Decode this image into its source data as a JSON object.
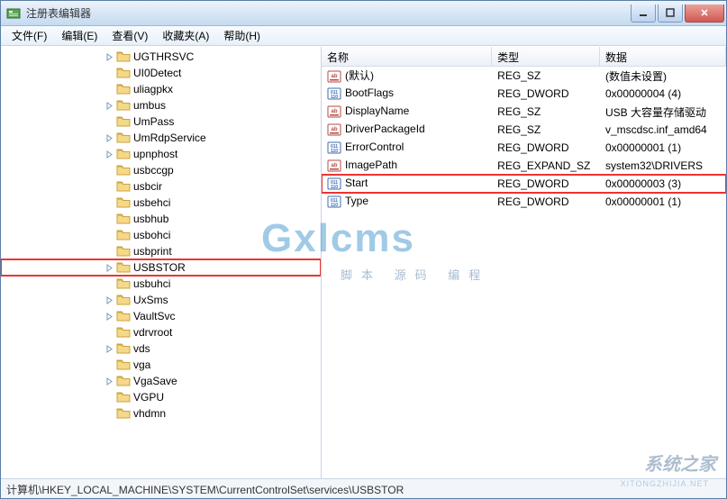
{
  "window": {
    "title": "注册表编辑器"
  },
  "menu": {
    "file": "文件(F)",
    "edit": "编辑(E)",
    "view": "查看(V)",
    "favorites": "收藏夹(A)",
    "help": "帮助(H)"
  },
  "tree": {
    "items": [
      {
        "label": "UGTHRSVC",
        "expander": "closed"
      },
      {
        "label": "UI0Detect",
        "expander": "none"
      },
      {
        "label": "uliagpkx",
        "expander": "none"
      },
      {
        "label": "umbus",
        "expander": "closed"
      },
      {
        "label": "UmPass",
        "expander": "none"
      },
      {
        "label": "UmRdpService",
        "expander": "closed"
      },
      {
        "label": "upnphost",
        "expander": "closed"
      },
      {
        "label": "usbccgp",
        "expander": "none"
      },
      {
        "label": "usbcir",
        "expander": "none"
      },
      {
        "label": "usbehci",
        "expander": "none"
      },
      {
        "label": "usbhub",
        "expander": "none"
      },
      {
        "label": "usbohci",
        "expander": "none"
      },
      {
        "label": "usbprint",
        "expander": "none"
      },
      {
        "label": "USBSTOR",
        "expander": "closed",
        "highlighted": true
      },
      {
        "label": "usbuhci",
        "expander": "none"
      },
      {
        "label": "UxSms",
        "expander": "closed"
      },
      {
        "label": "VaultSvc",
        "expander": "closed"
      },
      {
        "label": "vdrvroot",
        "expander": "none"
      },
      {
        "label": "vds",
        "expander": "closed"
      },
      {
        "label": "vga",
        "expander": "none"
      },
      {
        "label": "VgaSave",
        "expander": "closed"
      },
      {
        "label": "VGPU",
        "expander": "none"
      },
      {
        "label": "vhdmn",
        "expander": "none"
      }
    ]
  },
  "list": {
    "header": {
      "name": "名称",
      "type": "类型",
      "data": "数据"
    },
    "rows": [
      {
        "icon": "string",
        "name": "(默认)",
        "type": "REG_SZ",
        "data": "(数值未设置)"
      },
      {
        "icon": "binary",
        "name": "BootFlags",
        "type": "REG_DWORD",
        "data": "0x00000004 (4)"
      },
      {
        "icon": "string",
        "name": "DisplayName",
        "type": "REG_SZ",
        "data": "USB 大容量存储驱动"
      },
      {
        "icon": "string",
        "name": "DriverPackageId",
        "type": "REG_SZ",
        "data": "v_mscdsc.inf_amd64"
      },
      {
        "icon": "binary",
        "name": "ErrorControl",
        "type": "REG_DWORD",
        "data": "0x00000001 (1)"
      },
      {
        "icon": "string",
        "name": "ImagePath",
        "type": "REG_EXPAND_SZ",
        "data": "system32\\DRIVERS"
      },
      {
        "icon": "binary",
        "name": "Start",
        "type": "REG_DWORD",
        "data": "0x00000003 (3)",
        "highlighted": true
      },
      {
        "icon": "binary",
        "name": "Type",
        "type": "REG_DWORD",
        "data": "0x00000001 (1)"
      }
    ]
  },
  "statusbar": {
    "path": "计算机\\HKEY_LOCAL_MACHINE\\SYSTEM\\CurrentControlSet\\services\\USBSTOR"
  },
  "watermark": {
    "main": "Gxlcms",
    "sub": "脚本 源码 编程",
    "logo2": "系统之家",
    "logo2sub": "XITONGZHIJIA.NET"
  }
}
